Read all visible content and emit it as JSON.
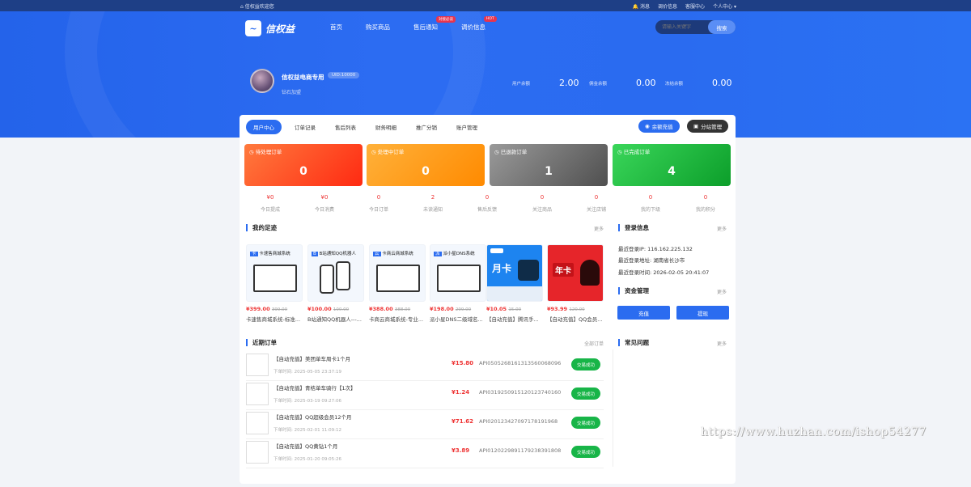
{
  "topbar": {
    "welcome": "信权益欢迎您",
    "links": [
      "消息",
      "调价信息",
      "客服中心",
      "个人中心"
    ]
  },
  "logo": {
    "text": "信权益"
  },
  "nav": [
    {
      "label": "首页",
      "badge": ""
    },
    {
      "label": "购买商品",
      "badge": ""
    },
    {
      "label": "售后通知",
      "badge": "对接必读"
    },
    {
      "label": "调价信息",
      "badge": "HOT"
    }
  ],
  "search": {
    "placeholder": "请输入关键字",
    "button": "搜索"
  },
  "user": {
    "name": "信权益电商专用",
    "uid": "UID:10000",
    "level": "钻石加盟"
  },
  "stats": [
    {
      "label": "用户余额",
      "value": "2.00"
    },
    {
      "label": "佣金余额",
      "value": "0.00"
    },
    {
      "label": "冻结余额",
      "value": "0.00"
    }
  ],
  "tabs": [
    "用户中心",
    "订单记录",
    "售后列表",
    "财务明细",
    "推广分销",
    "账户管理"
  ],
  "actions": {
    "recharge": "余额充值",
    "substation": "分站管理"
  },
  "order_cards": [
    {
      "label": "待处理订单",
      "value": "0",
      "color": "#ff4a1a"
    },
    {
      "label": "处理中订单",
      "value": "0",
      "color": "#ff9a0a"
    },
    {
      "label": "已退款订单",
      "value": "1",
      "color": "#6f6f6f"
    },
    {
      "label": "已完成订单",
      "value": "4",
      "color": "#1bb33c"
    }
  ],
  "mini_stats": [
    {
      "value": "¥0",
      "label": "今日提成"
    },
    {
      "value": "¥0",
      "label": "今日消费"
    },
    {
      "value": "0",
      "label": "今日订单"
    },
    {
      "value": "2",
      "label": "未读通知"
    },
    {
      "value": "0",
      "label": "售后反馈"
    },
    {
      "value": "0",
      "label": "关注商品"
    },
    {
      "value": "0",
      "label": "关注店铺"
    },
    {
      "value": "0",
      "label": "我的下级"
    },
    {
      "value": "0",
      "label": "我的积分"
    }
  ],
  "footprint": {
    "title": "我的足迹",
    "more": "更多",
    "products": [
      {
        "banner": "卡速售商城系统",
        "price": "¥399.00",
        "old": "399.00",
        "name": "卡速售商城系统-标准..."
      },
      {
        "banner": "B站通知QQ机器人",
        "price": "¥100.00",
        "old": "100.00",
        "name": "B站通知QQ机器人---..."
      },
      {
        "banner": "卡商云商城系统",
        "price": "¥388.00",
        "old": "388.00",
        "name": "卡商云商城系统-专业..."
      },
      {
        "banner": "派小星DNS系统",
        "price": "¥198.00",
        "old": "299.00",
        "name": "派小星DNS二级域名..."
      },
      {
        "banner": "月卡",
        "price": "¥10.05",
        "old": "15.00",
        "name": "【自动充值】腾讯手..."
      },
      {
        "banner": "年卡",
        "price": "¥93.99",
        "old": "120.00",
        "name": "【自动充值】QQ会员..."
      }
    ]
  },
  "recent_orders": {
    "title": "近期订单",
    "more": "全部订单",
    "time_label": "下单时间:",
    "rows": [
      {
        "title": "【自动充值】美团单车周卡1个月",
        "time": "2025-05-05 23:37:19",
        "price": "¥15.80",
        "no": "API050526816131356006809​6",
        "status": "交易成功"
      },
      {
        "title": "【自动充值】青桔单车骑行【1次】",
        "time": "2025-03-19 09:27:06",
        "price": "¥1.24",
        "no": "API031925091512012374016​0",
        "status": "交易成功"
      },
      {
        "title": "【自动充值】QQ超级会员12个月",
        "time": "2025-02-01 11:09:12",
        "price": "¥71.62",
        "no": "API020123427097178191968",
        "status": "交易成功"
      },
      {
        "title": "【自动充值】QQ黄钻1个月",
        "time": "2025-01-20 09:05:26",
        "price": "¥3.89",
        "no": "API012022989117923839180​8",
        "status": "交易成功"
      }
    ]
  },
  "login_info": {
    "title": "登录信息",
    "more": "更多",
    "ip": "最近登录IP: 116.162.225.132",
    "location": "最近登录地址: 湖南省长沙市",
    "time": "最近登录时间: 2026-02-05 20:41:07"
  },
  "funds": {
    "title": "资金管理",
    "more": "更多",
    "recharge": "充值",
    "withdraw": "提现"
  },
  "faq": {
    "title": "常见问题",
    "more": "更多"
  },
  "watermark": "https://www.huzhan.com/ishop54277"
}
